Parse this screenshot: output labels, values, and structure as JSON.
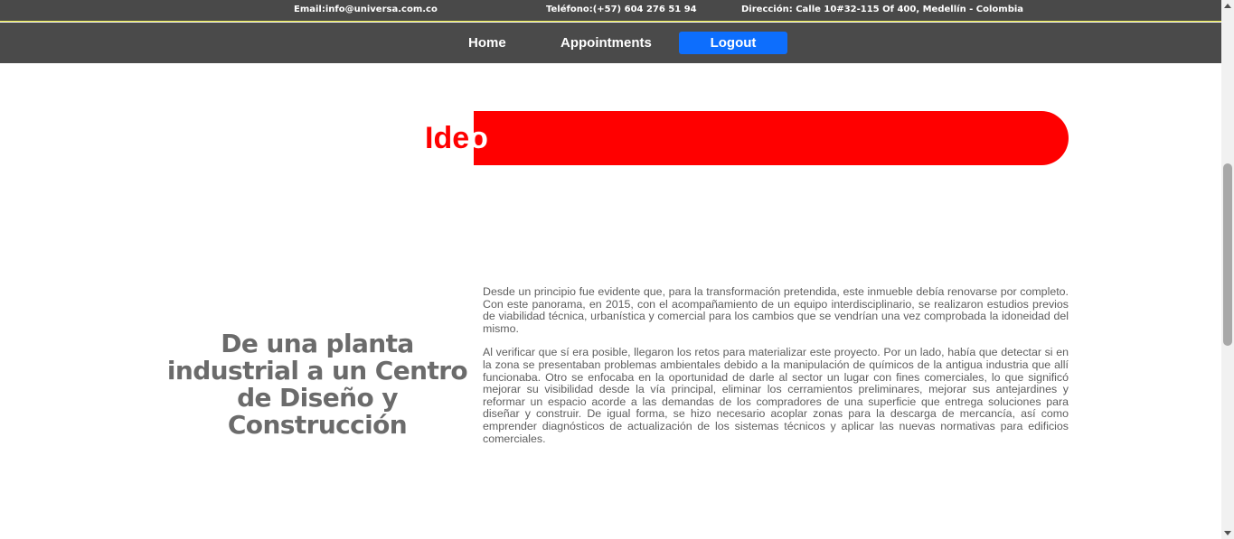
{
  "topbar": {
    "email": "Email:info@universa.com.co",
    "phone": "Teléfono:(+57) 604 276 51 94",
    "address": "Dirección: Calle 10#32-115 Of 400, Medellín - Colombia"
  },
  "nav": {
    "home": "Home",
    "appointments": "Appointments",
    "logout": "Logout"
  },
  "banner": {
    "title_red": "Ide",
    "title_white": "o",
    "color": "#ff0000"
  },
  "section": {
    "heading": "De una planta industrial a un Centro de Diseño y Construcción",
    "paragraph_1": "Desde un principio fue evidente que, para la transformación pretendida, este inmueble debía renovarse por completo. Con este panorama, en 2015, con el acompañamiento de un equipo interdisciplinario, se realizaron estudios previos de viabilidad técnica, urbanística y comercial para los cambios que se vendrían una vez comprobada la idoneidad del mismo.",
    "paragraph_2": "Al verificar que sí era posible, llegaron los retos para materializar este proyecto. Por un lado, había que detectar si en la zona se presentaban problemas ambientales debido a la manipulación de químicos de la antigua industria que allí funcionaba. Otro se enfocaba en la oportunidad de darle al sector un lugar con fines comerciales, lo que significó mejorar su visibilidad desde la vía principal, eliminar los cerramientos preliminares, mejorar sus antejardines y reformar un espacio acorde a las demandas de los compradores de una superficie que entrega soluciones para diseñar y construir. De igual forma, se hizo necesario acoplar zonas para la descarga de mercancía, así como emprender diagnósticos de actualización de los sistemas técnicos y aplicar las nuevas normativas para edificios comerciales."
  },
  "colors": {
    "topbar_bg": "#494949",
    "navbar_bg": "#4a4a4a",
    "logout_bg": "#0d6efd",
    "accent_line": "#e2e23a"
  }
}
